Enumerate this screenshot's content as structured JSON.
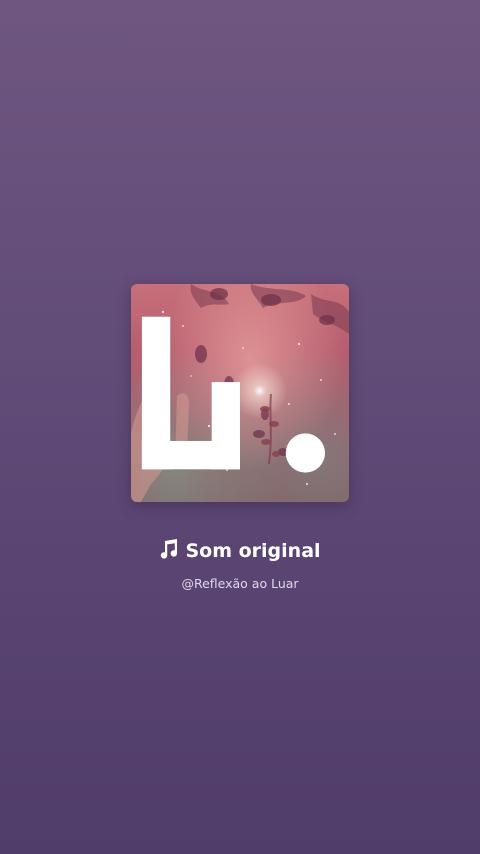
{
  "sound": {
    "title": "Som original",
    "author": "@Reflexão ao Luar",
    "icon": "music-note-icon"
  },
  "cover": {
    "description_icon": "album-cover",
    "brand_icon": "brand-logo-icon"
  },
  "colors": {
    "background_top": "#6e5680",
    "background_bottom": "#513d69",
    "title_text": "#ffffff",
    "author_text": "#e2d7ea"
  }
}
